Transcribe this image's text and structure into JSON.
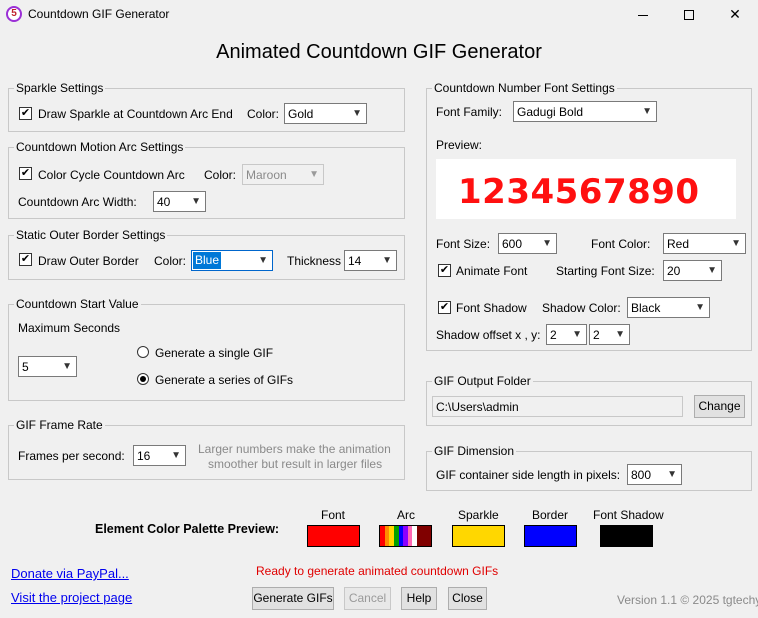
{
  "window": {
    "icon_glyph": "5",
    "title": "Countdown GIF Generator",
    "controls": [
      "minimize-icon",
      "maximize-icon",
      "close-icon"
    ]
  },
  "heading": "Animated Countdown GIF Generator",
  "sparkle": {
    "title": "Sparkle Settings",
    "draw_label": "Draw Sparkle at Countdown Arc End",
    "draw_checked": true,
    "color_label": "Color:",
    "color_value": "Gold"
  },
  "arc": {
    "title": "Countdown Motion Arc Settings",
    "cycle_label": "Color Cycle Countdown Arc",
    "cycle_checked": true,
    "color_label": "Color:",
    "color_value": "Maroon",
    "width_label": "Countdown Arc Width:",
    "width_value": "40"
  },
  "border": {
    "title": "Static Outer Border Settings",
    "draw_label": "Draw Outer Border",
    "draw_checked": true,
    "color_label": "Color:",
    "color_value": "Blue",
    "thickness_label": "Thickness",
    "thickness_value": "14"
  },
  "start": {
    "title": "Countdown Start Value",
    "max_label": "Maximum Seconds",
    "max_value": "5",
    "single_label": "Generate a single GIF",
    "series_label": "Generate a series of GIFs",
    "selected": "series"
  },
  "framerate": {
    "title": "GIF Frame Rate",
    "fps_label": "Frames per second:",
    "fps_value": "16",
    "hint_line1": "Larger numbers make the animation",
    "hint_line2": "smoother but result in larger files"
  },
  "font": {
    "title": "Countdown Number Font Settings",
    "family_label": "Font Family:",
    "family_value": "Gadugi Bold",
    "preview_label": "Preview:",
    "preview_text": "1234567890",
    "preview_color": "#ff1010",
    "size_label": "Font Size:",
    "size_value": "600",
    "color_label": "Font Color:",
    "color_value": "Red",
    "animate_label": "Animate Font",
    "animate_checked": true,
    "start_size_label": "Starting Font Size:",
    "start_size_value": "20",
    "shadow_label": "Font Shadow",
    "shadow_checked": true,
    "shadow_color_label": "Shadow Color:",
    "shadow_color_value": "Black",
    "offset_label": "Shadow offset x , y:",
    "offset_x": "2",
    "offset_y": "2"
  },
  "output": {
    "title": "GIF Output Folder",
    "path": "C:\\Users\\admin",
    "change_label": "Change"
  },
  "dimension": {
    "title": "GIF Dimension",
    "side_label": "GIF container side length in pixels:",
    "side_value": "800"
  },
  "palette": {
    "label": "Element Color Palette Preview:",
    "items": [
      {
        "name": "Font",
        "color": "#ff0000"
      },
      {
        "name": "Arc",
        "colors": [
          "#ff0000",
          "#ff8c00",
          "#ffd700",
          "#00a000",
          "#0000ff",
          "#8b00ff",
          "#ff69b4",
          "#ffffff",
          "#800000"
        ]
      },
      {
        "name": "Sparkle",
        "color": "#ffd700"
      },
      {
        "name": "Border",
        "color": "#0000ff"
      },
      {
        "name": "Font Shadow",
        "color": "#000000"
      }
    ]
  },
  "footer": {
    "paypal": "Donate via PayPal...",
    "project": "Visit the project page",
    "status": "Ready to generate animated countdown GIFs",
    "generate": "Generate GIFs",
    "cancel": "Cancel",
    "help": "Help",
    "close": "Close",
    "version": "Version 1.1 © 2025 tgtechy"
  }
}
